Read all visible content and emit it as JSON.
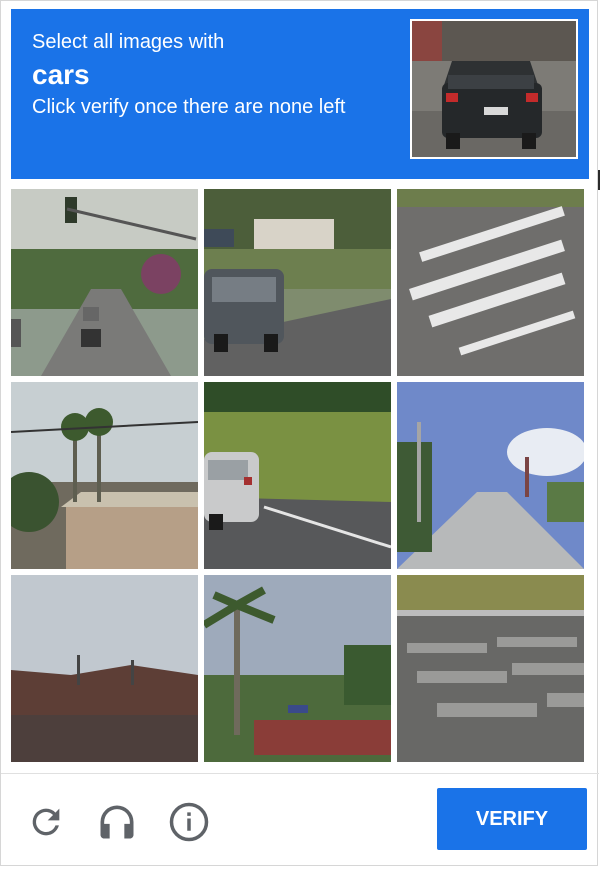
{
  "header": {
    "instruction": "Select all images with",
    "target": "cars",
    "hint": "Click verify once there are none left",
    "example_image": "car-rear-example"
  },
  "grid": {
    "tiles": [
      {
        "scene": "street-traffic-light-cars"
      },
      {
        "scene": "suv-parked-street"
      },
      {
        "scene": "road-markings"
      },
      {
        "scene": "palm-trees-house"
      },
      {
        "scene": "car-on-road-grass"
      },
      {
        "scene": "street-with-trees"
      },
      {
        "scene": "hills-power-lines"
      },
      {
        "scene": "palm-tree-fence"
      },
      {
        "scene": "crosswalk"
      }
    ]
  },
  "footer": {
    "reload_icon": "reload-icon",
    "audio_icon": "headphones-icon",
    "info_icon": "info-icon",
    "verify_label": "VERIFY"
  },
  "colors": {
    "accent": "#1a73e8",
    "icon": "#5f6368"
  }
}
